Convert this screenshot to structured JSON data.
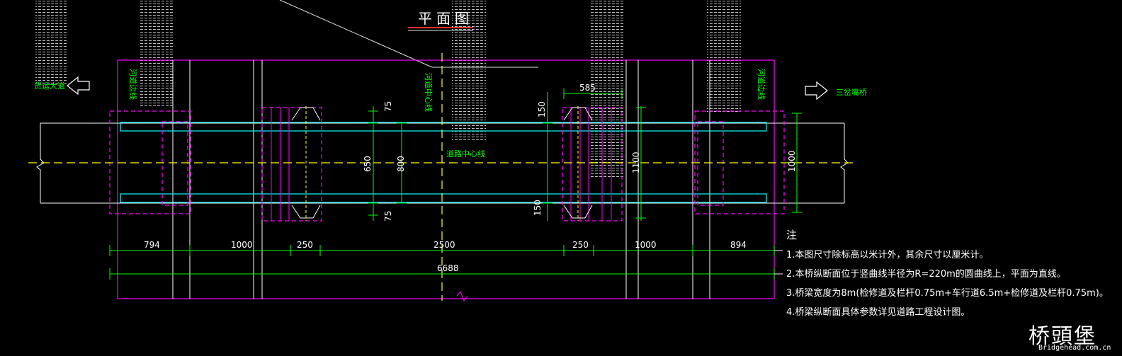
{
  "title": "平面图",
  "labels": {
    "bank_left": "河道边线",
    "bank_right": "河道边线",
    "river_center": "河道中心线",
    "road_center": "道路中心线",
    "dir_left": "货运大道",
    "dir_right": "三岔嘴桥"
  },
  "dims": {
    "h_0": "794",
    "h_1": "1000",
    "h_2": "250",
    "h_3": "2500",
    "h_4": "250",
    "h_5": "1000",
    "h_6": "894",
    "total": "6688",
    "v_585": "585",
    "v_75a": "75",
    "v_650": "650",
    "v_800": "800",
    "v_75b": "75",
    "v_150a": "150",
    "v_150b": "150",
    "v_1100": "1100",
    "v_1000": "1000"
  },
  "notes": {
    "heading": "注",
    "items": [
      "1.本图尺寸除标高以米计外，其余尺寸以厘米计。",
      "2.本桥纵断面位于竖曲线半径为R=220m的圆曲线上，平面为直线。",
      "3.桥梁宽度为8m(检修道及栏杆0.75m+车行道6.5m+检修道及栏杆0.75m)。",
      "4.桥梁纵断面具体参数详见道路工程设计图。"
    ]
  },
  "watermark": {
    "name": "桥頭堡",
    "url": "Bridgehead.com.cn"
  },
  "colors": {
    "background": "#000000",
    "frame": "#ff00ff",
    "dimension": "#00ff00",
    "kerb": "#00ffff",
    "centerline": "#ffff00",
    "title_underline": "#ff3030"
  }
}
